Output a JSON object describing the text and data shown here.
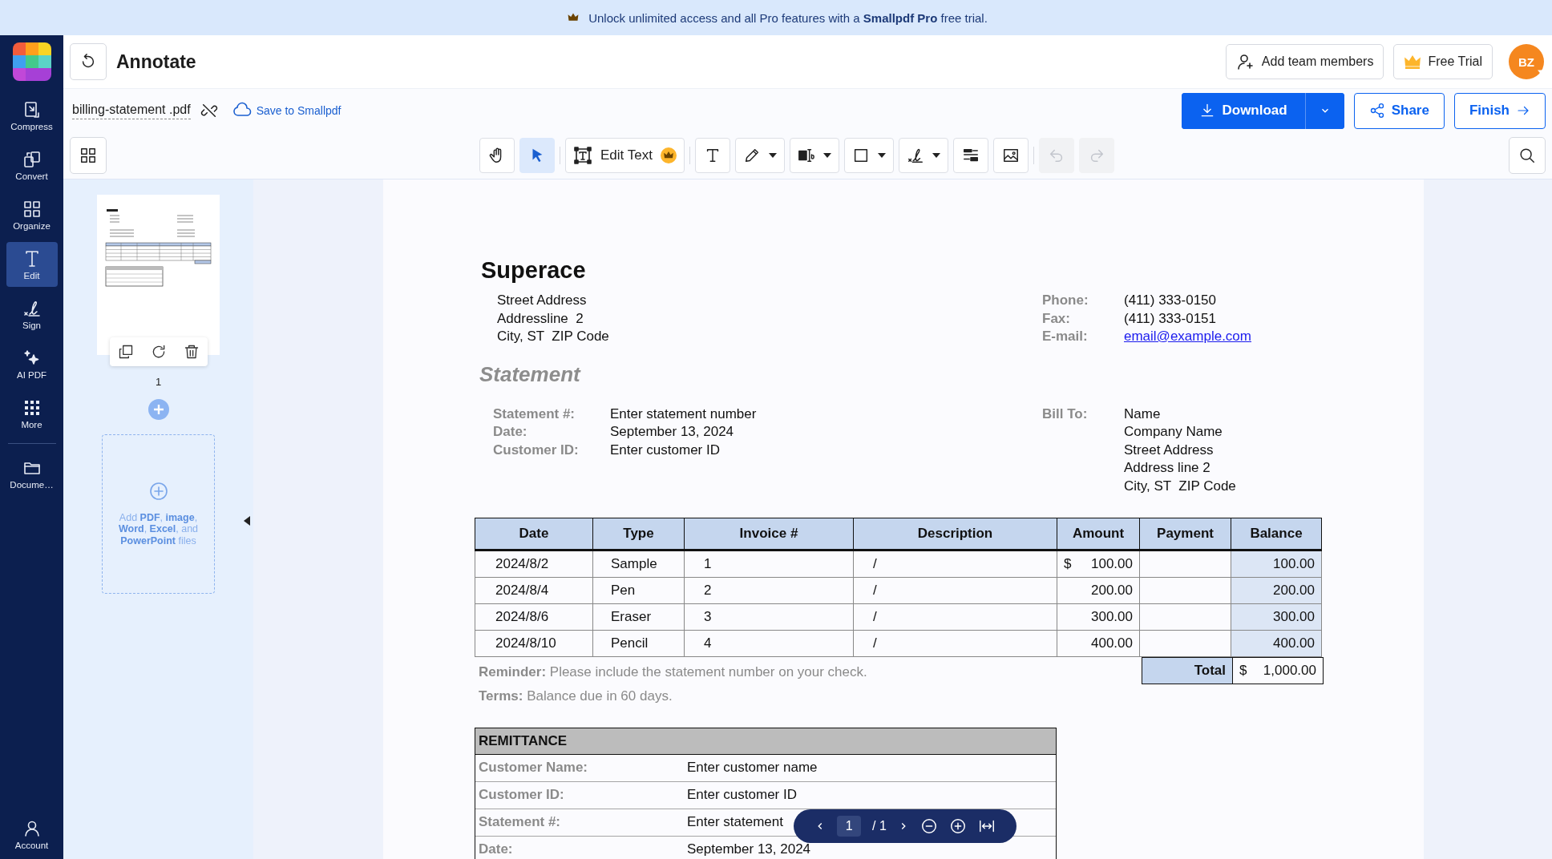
{
  "banner": {
    "text": "Unlock unlimited access and all Pro features with a **Smallpdf Pro** free trial."
  },
  "sidebar": {
    "items": [
      {
        "label": "Compress",
        "selected": false
      },
      {
        "label": "Convert",
        "selected": false
      },
      {
        "label": "Organize",
        "selected": false
      },
      {
        "label": "Edit",
        "selected": true
      },
      {
        "label": "Sign",
        "selected": false
      },
      {
        "label": "AI PDF",
        "selected": false
      },
      {
        "label": "More",
        "selected": false
      },
      {
        "label": "Docume…",
        "selected": false
      }
    ],
    "account": {
      "label": "Account"
    }
  },
  "header": {
    "title": "Annotate",
    "add_members": "Add team members",
    "free_trial": "Free Trial",
    "avatar": "BZ"
  },
  "file": {
    "name": "billing-statement .pdf",
    "save": "Save to Smallpdf"
  },
  "actions": {
    "download": "Download",
    "share": "Share",
    "finish": "Finish"
  },
  "toolbar": [
    {
      "kind": "tool",
      "selected": false
    },
    {
      "kind": "tool",
      "selected": true
    },
    {
      "kind": "label",
      "label": "Edit Text",
      "premium": true,
      "selected": false
    },
    {
      "kind": "tool",
      "selected": false
    },
    {
      "kind": "tool",
      "selected": false,
      "dropdown": true
    },
    {
      "kind": "tool",
      "selected": false,
      "dropdown": true
    },
    {
      "kind": "tool",
      "selected": false,
      "dropdown": true
    },
    {
      "kind": "tool",
      "selected": false,
      "dropdown": true
    },
    {
      "kind": "tool",
      "selected": false
    },
    {
      "kind": "tool",
      "selected": false
    },
    {
      "kind": "history",
      "disabled": true
    },
    {
      "kind": "history",
      "disabled": true
    }
  ],
  "thumbnails": {
    "page_number": "1",
    "add_files": "Add **PDF**, **image**, **Word**, **Excel**, and **PowerPoint** files"
  },
  "document": {
    "company": "Superace",
    "address": [
      "Street Address",
      "Addressline  2",
      "City, ST  ZIP Code"
    ],
    "contacts": [
      {
        "label": "Phone:",
        "value": "(411) 333-0150",
        "kind": "text"
      },
      {
        "label": "Fax:",
        "value": "(411) 333-0151",
        "kind": "text"
      },
      {
        "label": "E-mail:",
        "value": "email@example.com",
        "kind": "link"
      }
    ],
    "heading": "Statement",
    "fields": [
      {
        "label": "Statement #:",
        "value": "Enter statement number"
      },
      {
        "label": "Date:",
        "value": "September 13, 2024"
      },
      {
        "label": "Customer ID:",
        "value": "Enter customer ID"
      }
    ],
    "bill_to": {
      "label": "Bill To:",
      "lines": [
        "Name",
        "Company Name",
        "Street Address",
        "Address line 2",
        "City, ST  ZIP Code"
      ]
    },
    "table": {
      "columns": [
        "Date",
        "Type",
        "Invoice #",
        "Description",
        "Amount",
        "Payment",
        "Balance"
      ],
      "rows": [
        {
          "date": "2024/8/2",
          "type": "Sample",
          "invoice": "1",
          "description": "/",
          "currency": "$",
          "amount": "100.00",
          "balance": "100.00"
        },
        {
          "date": "2024/8/4",
          "type": "Pen",
          "invoice": "2",
          "description": "/",
          "amount": "200.00",
          "balance": "200.00"
        },
        {
          "date": "2024/8/6",
          "type": "Eraser",
          "invoice": "3",
          "description": "/",
          "amount": "300.00",
          "balance": "300.00"
        },
        {
          "date": "2024/8/10",
          "type": "Pencil",
          "invoice": "4",
          "description": "/",
          "amount": "400.00",
          "balance": "400.00"
        }
      ],
      "total": {
        "label": "Total",
        "currency": "$",
        "value": "1,000.00"
      }
    },
    "notes": [
      "**Reminder:** Please include the statement number on your check.",
      "**Terms:** Balance due in 60 days."
    ],
    "remittance": {
      "title": "REMITTANCE",
      "rows": [
        {
          "label": "Customer Name:",
          "value": "Enter customer name"
        },
        {
          "label": "Customer ID:",
          "value": "Enter customer ID"
        },
        {
          "label": "Statement #:",
          "value": "Enter statement"
        },
        {
          "label": "Date:",
          "value": "September 13, 2024"
        }
      ]
    }
  },
  "pager": {
    "page": "1",
    "total": "/ 1"
  }
}
